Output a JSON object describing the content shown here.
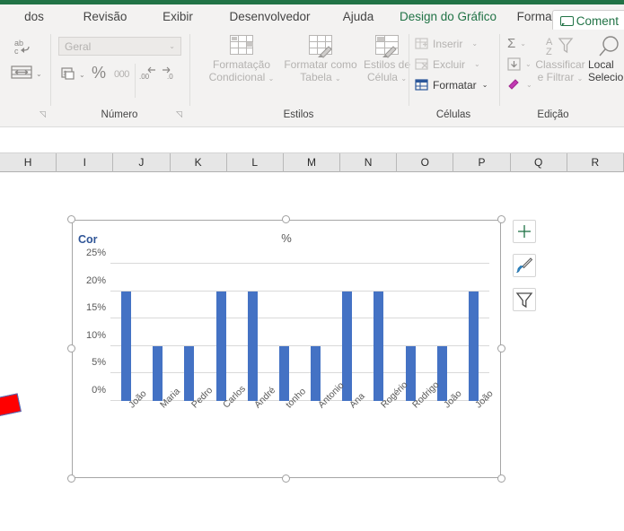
{
  "window": {
    "accent_green": "#217346",
    "ribbon_bg": "#f3f2f1"
  },
  "tabs": [
    {
      "label": "dos",
      "contextual": false
    },
    {
      "label": "Revisão",
      "contextual": false
    },
    {
      "label": "Exibir",
      "contextual": false
    },
    {
      "label": "Desenvolvedor",
      "contextual": false
    },
    {
      "label": "Ajuda",
      "contextual": false
    },
    {
      "label": "Design do Gráfico",
      "contextual": true
    },
    {
      "label": "Formatar",
      "contextual": true
    }
  ],
  "comments_button": {
    "label": "Coment",
    "icon": "comment-icon"
  },
  "ribbon": {
    "groups": [
      {
        "name": "numero",
        "label": "Número",
        "format_select_value": "Geral",
        "buttons": [
          {
            "name": "wrap-text",
            "label": ""
          },
          {
            "name": "merge-center",
            "label": ""
          },
          {
            "name": "accounting-format",
            "label": ""
          },
          {
            "name": "percent-style",
            "label": "%"
          },
          {
            "name": "comma-style",
            "label": "000"
          },
          {
            "name": "increase-decimal",
            "label": ""
          },
          {
            "name": "decrease-decimal",
            "label": ""
          }
        ]
      },
      {
        "name": "estilos",
        "label": "Estilos",
        "buttons": [
          {
            "name": "conditional-formatting",
            "line1": "Formatação",
            "line2": "Condicional",
            "caret": "⌄"
          },
          {
            "name": "format-as-table",
            "line1": "Formatar como",
            "line2": "Tabela",
            "caret": "⌄"
          },
          {
            "name": "cell-styles",
            "line1": "Estilos de",
            "line2": "Célula",
            "caret": "⌄"
          }
        ]
      },
      {
        "name": "celulas",
        "label": "Células",
        "buttons": [
          {
            "name": "insert-cells",
            "label": "Inserir",
            "caret": "⌄",
            "enabled": false
          },
          {
            "name": "delete-cells",
            "label": "Excluir",
            "caret": "⌄",
            "enabled": false
          },
          {
            "name": "format-cells",
            "label": "Formatar",
            "caret": "⌄",
            "enabled": true
          }
        ]
      },
      {
        "name": "edicao",
        "label": "Edição",
        "buttons": [
          {
            "name": "autosum",
            "label": "Σ",
            "caret": "⌄"
          },
          {
            "name": "fill",
            "label": "",
            "caret": "⌄"
          },
          {
            "name": "clear",
            "label": "",
            "caret": "⌄"
          },
          {
            "name": "sort-filter",
            "line1": "Classificar",
            "line2": "e Filtrar",
            "caret": "⌄"
          },
          {
            "name": "find-select",
            "line1": "Local",
            "line2": "Selecio"
          }
        ]
      }
    ]
  },
  "columns": [
    "H",
    "I",
    "J",
    "K",
    "L",
    "M",
    "N",
    "O",
    "P",
    "Q",
    "R"
  ],
  "chart": {
    "corner_label": "Cor",
    "floating_buttons": [
      {
        "name": "chart-elements-button",
        "icon": "plus-icon"
      },
      {
        "name": "chart-styles-button",
        "icon": "paintbrush-icon"
      },
      {
        "name": "chart-filters-button",
        "icon": "funnel-icon"
      }
    ]
  },
  "chart_data": {
    "type": "bar",
    "title": "%",
    "xlabel": "",
    "ylabel": "",
    "categories": [
      "João",
      "Maria",
      "Pedro",
      "Carlos",
      "André",
      "tonho",
      "Antonio",
      "Ana",
      "Rogério",
      "Rodrigo",
      "João",
      "João"
    ],
    "values": [
      20,
      10,
      10,
      20,
      20,
      10,
      10,
      20,
      20,
      10,
      10,
      20
    ],
    "ylim": [
      0,
      25
    ],
    "ytick_values": [
      0,
      5,
      10,
      15,
      20,
      25
    ],
    "ytick_labels": [
      "0%",
      "5%",
      "10%",
      "15%",
      "20%",
      "25%"
    ],
    "series_color": "#4472c4",
    "grid": true,
    "legend": "none"
  }
}
